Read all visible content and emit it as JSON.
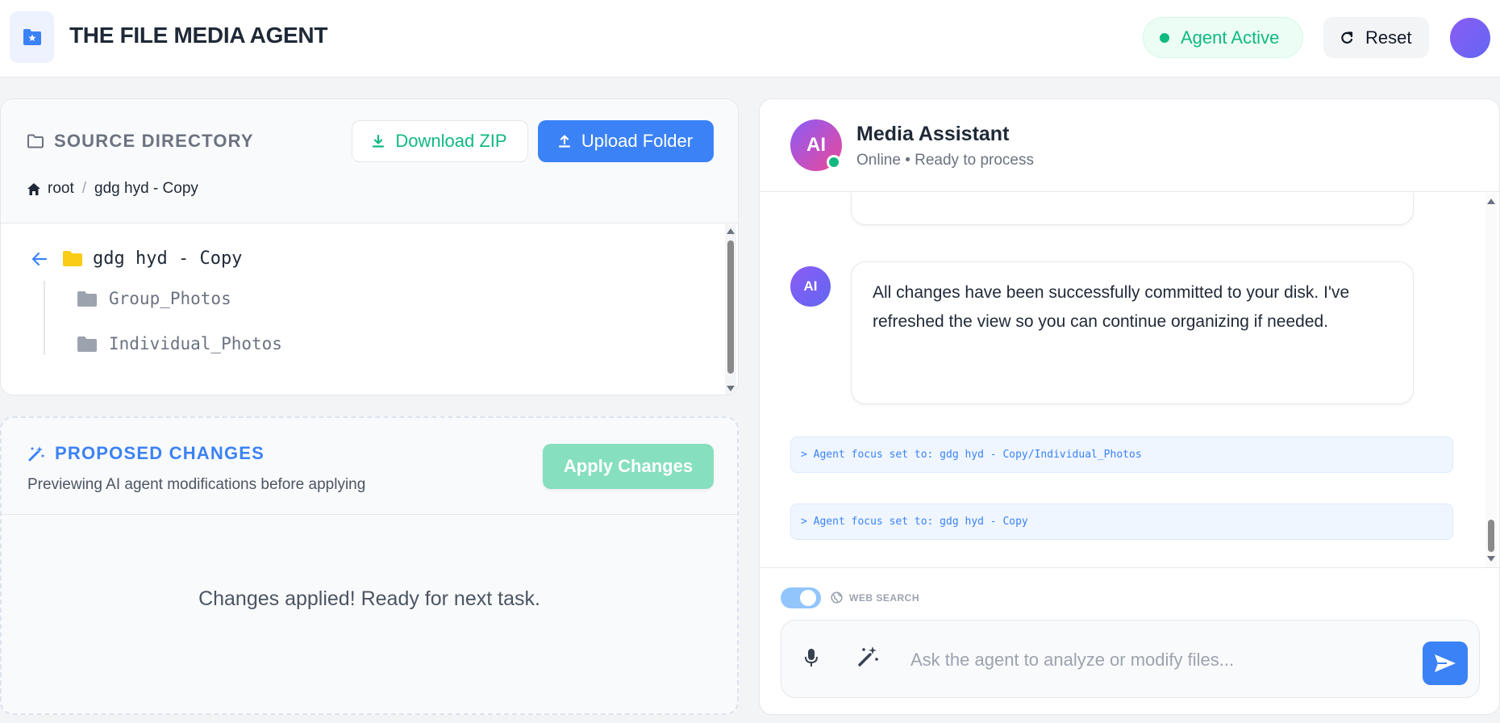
{
  "header": {
    "title": "THE FILE MEDIA AGENT",
    "status_label": "Agent Active",
    "reset_label": "Reset"
  },
  "source": {
    "title": "SOURCE DIRECTORY",
    "download_label": "Download ZIP",
    "upload_label": "Upload Folder",
    "breadcrumb": [
      "root",
      "gdg hyd - Copy"
    ],
    "current_folder": "gdg hyd - Copy",
    "children": [
      "Group_Photos",
      "Individual_Photos"
    ]
  },
  "changes": {
    "title": "PROPOSED CHANGES",
    "subtitle": "Previewing AI agent modifications before applying",
    "apply_label": "Apply Changes",
    "message": "Changes applied! Ready for next task."
  },
  "chat": {
    "avatar_text": "AI",
    "assistant_name": "Media Assistant",
    "assistant_status": "Online • Ready to process",
    "messages": [
      {
        "sender": "AI",
        "text": "All changes have been successfully committed to your disk. I've refreshed the view so you can continue organizing if needed."
      }
    ],
    "logs": [
      "> Agent focus set to: gdg hyd - Copy/Individual_Photos",
      "> Agent focus set to: gdg hyd - Copy"
    ],
    "web_search_label": "WEB SEARCH",
    "web_search_enabled": true,
    "input_placeholder": "Ask the agent to analyze or modify files..."
  },
  "colors": {
    "accent": "#3b82f6",
    "success": "#10b981",
    "folder": "#facc15"
  }
}
